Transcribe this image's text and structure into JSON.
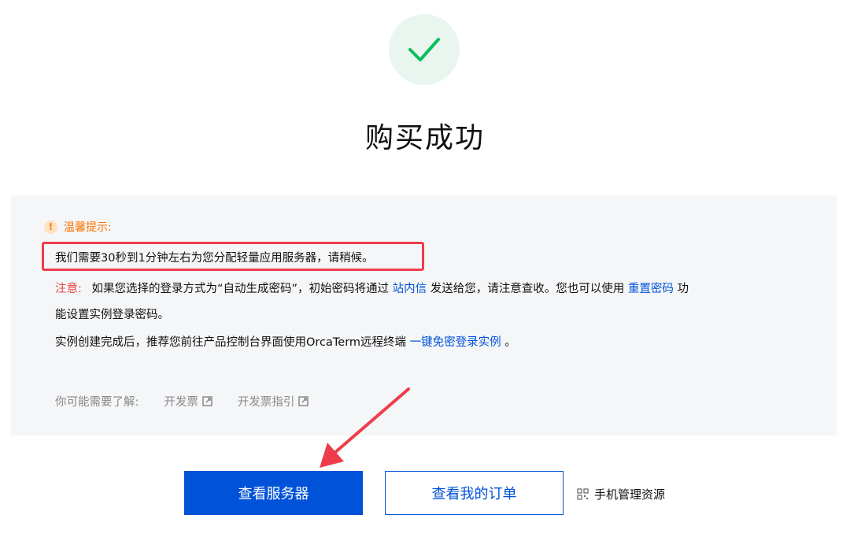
{
  "page": {
    "title": "购买成功"
  },
  "notice": {
    "tip_label": "温馨提示:",
    "tip_icon": "exclamation-icon",
    "highlight_text": "我们需要30秒到1分钟左右为您分配轻量应用服务器，请稍候。",
    "note_label": "注意:",
    "note_text_1": "如果您选择的登录方式为“自动生成密码”，初始密码将通过",
    "note_link_1": "站内信",
    "note_text_2": "发送给您，请注意查收。您也可以使用",
    "note_link_2": "重置密码",
    "note_text_3": "功",
    "note_text_4": "能设置实例登录密码。",
    "orca_text": "实例创建完成后，推荐您前往产品控制台界面使用OrcaTerm远程终端",
    "orca_link": "一键免密登录实例",
    "orca_end": "。"
  },
  "learn_more": {
    "label": "你可能需要了解:",
    "links": [
      "开发票",
      "开发票指引"
    ]
  },
  "actions": {
    "primary": "查看服务器",
    "secondary": "查看我的订单",
    "mobile": "手机管理资源"
  },
  "colors": {
    "accent": "#0052d9",
    "success": "#0abf5b",
    "warning": "#ff7200",
    "highlight": "#ee3d4a"
  }
}
